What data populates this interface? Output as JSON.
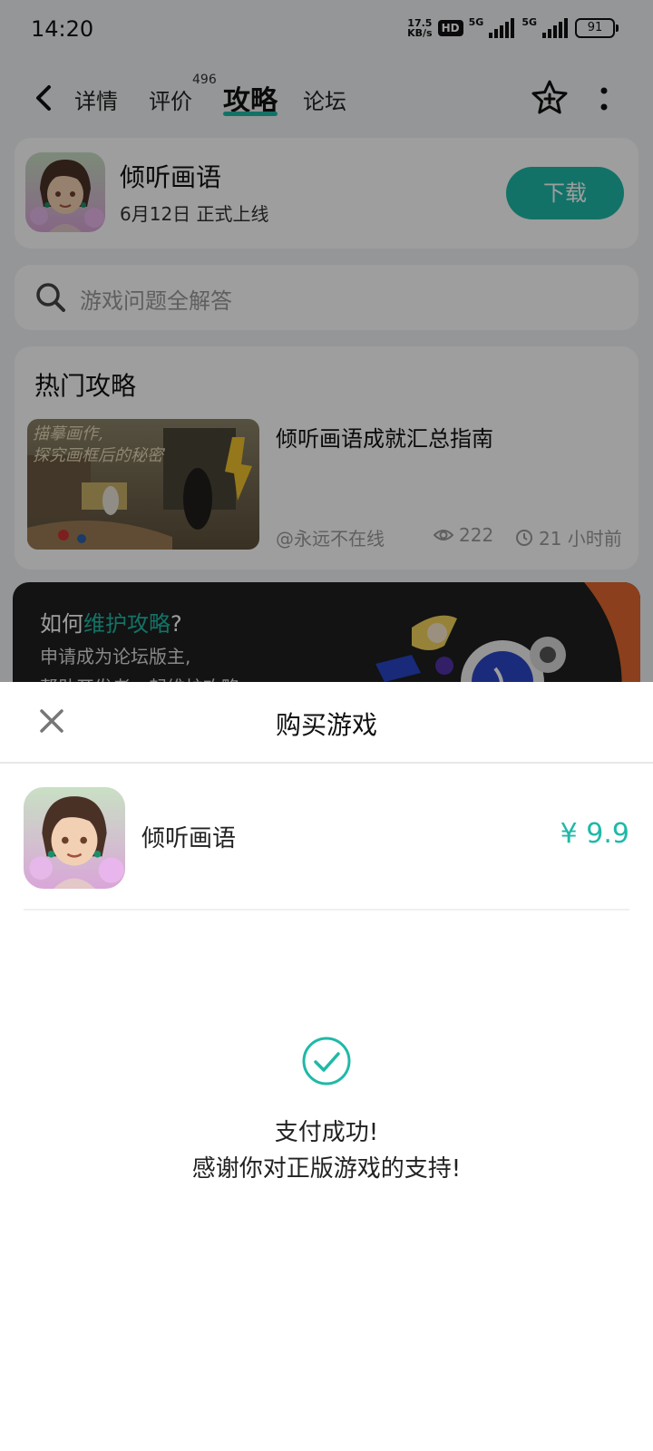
{
  "status_bar": {
    "time": "14:20",
    "net_speed_value": "17.5",
    "net_speed_unit": "KB/s",
    "hd_label": "HD",
    "net1": "5G",
    "net2": "5G",
    "battery": "91"
  },
  "nav": {
    "tabs": [
      {
        "label": "详情"
      },
      {
        "label": "评价"
      },
      {
        "label": "攻略"
      },
      {
        "label": "论坛"
      }
    ],
    "review_count": "496",
    "active_tab": "攻略",
    "accent_color": "#1fb9a7"
  },
  "game": {
    "title": "倾听画语",
    "release_date": "6月12日 正式上线",
    "download_label": "下载"
  },
  "search": {
    "placeholder": "游戏问题全解答"
  },
  "hot_guides": {
    "section_title": "热门攻略",
    "thumbnail_text_line1": "描摹画作,",
    "thumbnail_text_line2": "探究画框后的秘密",
    "article_title": "倾听画语成就汇总指南",
    "author": "@永远不在线",
    "views": "222",
    "time_ago": "21 小时前"
  },
  "banner": {
    "title_prefix": "如何",
    "title_highlight": "维护攻略",
    "title_suffix": "?",
    "subtitle_line1": "申请成为论坛版主,",
    "subtitle_line2": "帮助开发者一起维护攻略"
  },
  "purchase_sheet": {
    "title": "购买游戏",
    "item_name": "倾听画语",
    "price": "¥ 9.9",
    "success_line1": "支付成功!",
    "success_line2": "感谢你对正版游戏的支持!"
  }
}
